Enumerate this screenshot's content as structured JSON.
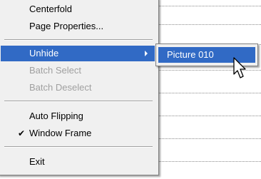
{
  "menu": {
    "items": [
      {
        "label": "Centerfold"
      },
      {
        "label": "Page Properties..."
      },
      {
        "label": "Unhide"
      },
      {
        "label": "Batch Select"
      },
      {
        "label": "Batch Deselect"
      },
      {
        "label": "Auto Flipping"
      },
      {
        "label": "Window Frame",
        "checked": true
      },
      {
        "label": "Exit"
      }
    ],
    "check_mark": "✔"
  },
  "submenu": {
    "items": [
      {
        "label": "Picture 010"
      }
    ]
  },
  "icons": {
    "submenu_arrow": "triangle-right-icon",
    "cursor": "mouse-pointer-icon"
  },
  "colors": {
    "highlight": "#316ac5",
    "menu_bg": "#f0f0f0",
    "disabled_text": "#a0a0a0"
  }
}
